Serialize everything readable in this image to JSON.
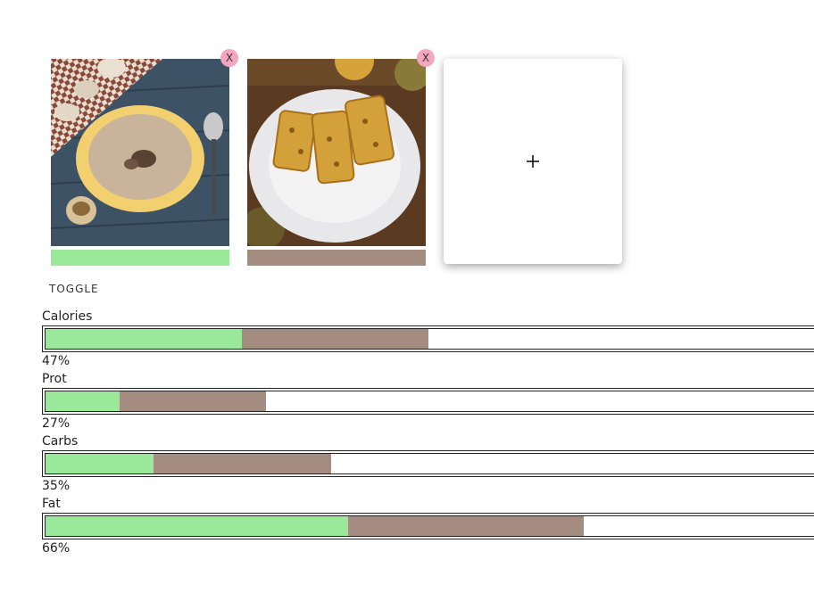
{
  "cards": [
    {
      "name": "mushroom-soup",
      "remove_label": "X",
      "bar_color": "#9ae89a"
    },
    {
      "name": "crepe-rolls",
      "remove_label": "X",
      "bar_color": "#a48c80"
    }
  ],
  "add_card": {
    "icon": "plus-icon",
    "symbol": "+"
  },
  "toggle_label": "TOGGLE",
  "colors": {
    "green": "#9ae89a",
    "brown": "#a48c80",
    "remove_bg": "#f4a6c1"
  },
  "metrics": [
    {
      "label": "Calories",
      "percent": "47%",
      "seg_a": 0.255,
      "seg_b": 0.243
    },
    {
      "label": "Prot",
      "percent": "27%",
      "seg_a": 0.096,
      "seg_b": 0.19
    },
    {
      "label": "Carbs",
      "percent": "35%",
      "seg_a": 0.14,
      "seg_b": 0.231
    },
    {
      "label": "Fat",
      "percent": "66%",
      "seg_a": 0.393,
      "seg_b": 0.307
    }
  ]
}
